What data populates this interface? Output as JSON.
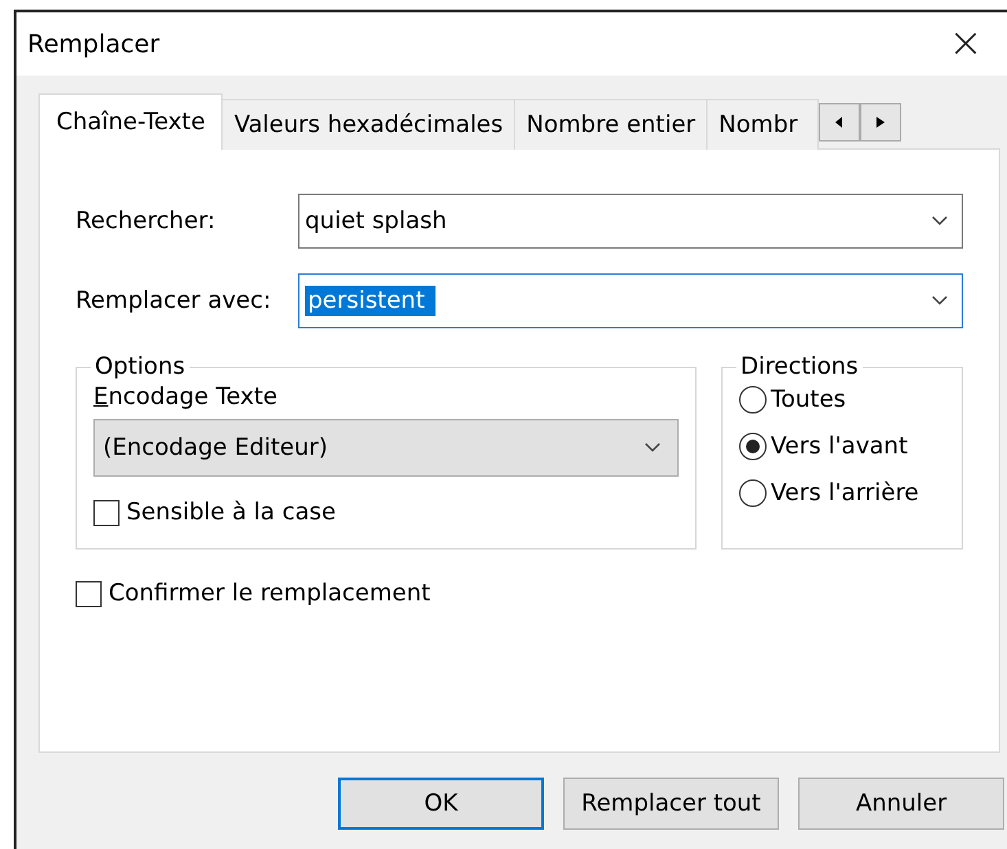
{
  "window": {
    "title": "Remplacer",
    "close": "×"
  },
  "tabs": [
    {
      "label": "Chaîne-Texte",
      "selected": true
    },
    {
      "label": "Valeurs hexadécimales",
      "selected": false
    },
    {
      "label": "Nombre entier",
      "selected": false
    },
    {
      "label": "Nombr",
      "selected": false
    }
  ],
  "fields": [
    {
      "label": "Rechercher:",
      "value": "quiet splash",
      "focused": false
    },
    {
      "label": "Remplacer avec:",
      "value": "persistent ",
      "focused": true
    }
  ],
  "options": {
    "title": "Options",
    "encoding_label": "Encodage Texte",
    "encoding_access_key": true,
    "encoding_value": "(Encodage Editeur)",
    "case_sensitive": {
      "label": "Sensible à la case",
      "checked": false
    }
  },
  "directions": {
    "title": "Directions",
    "items": [
      {
        "label": "Toutes",
        "selected": false
      },
      {
        "label": "Vers l'avant",
        "selected": true
      },
      {
        "label": "Vers l'arrière",
        "selected": false
      }
    ]
  },
  "confirm": {
    "label": "Confirmer le remplacement",
    "checked": false
  },
  "buttons": [
    {
      "label": "OK",
      "default": true
    },
    {
      "label": "Remplacer tout",
      "default": false
    },
    {
      "label": "Annuler",
      "default": false
    }
  ]
}
